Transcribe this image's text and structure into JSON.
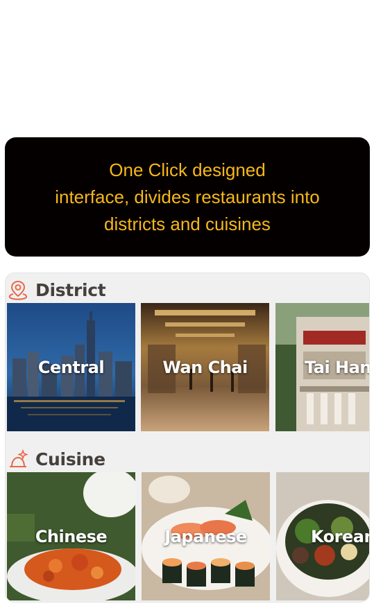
{
  "banner": {
    "lines": [
      "One Click designed",
      "interface, divides restaurants into",
      "districts and cuisines"
    ]
  },
  "district": {
    "title": "District",
    "icon": "map-pin-icon",
    "items": [
      {
        "label": "Central"
      },
      {
        "label": "Wan Chai"
      },
      {
        "label": "Tai Hang"
      }
    ]
  },
  "cuisine": {
    "title": "Cuisine",
    "icon": "chef-hat-icon",
    "items": [
      {
        "label": "Chinese"
      },
      {
        "label": "Japanese"
      },
      {
        "label": "Korean"
      }
    ]
  },
  "colors": {
    "banner_bg": "#050000",
    "banner_text": "#f6b81a",
    "icon_accent": "#e8674a",
    "section_text": "#45403c"
  }
}
